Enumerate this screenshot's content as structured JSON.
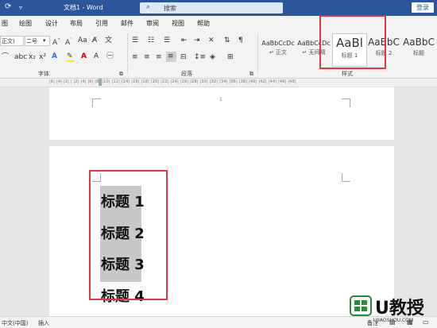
{
  "titlebar": {
    "save_icon": "save-icon",
    "dropdown_icon": "dropdown-icon",
    "title": "文档1 - Word",
    "search_placeholder": "搜索",
    "login_label": "登录"
  },
  "tabs": [
    "图",
    "绘图",
    "设计",
    "布局",
    "引用",
    "邮件",
    "审阅",
    "视图",
    "帮助"
  ],
  "ribbon": {
    "font_name": "正文)",
    "font_size": "二号",
    "font_group_label": "字体",
    "paragraph_group_label": "段落",
    "styles_group_label": "样式",
    "styles": [
      {
        "preview": "AaBbCcDc",
        "name": "↵ 正文"
      },
      {
        "preview": "AaBbCcDc",
        "name": "↵ 无间隔"
      },
      {
        "preview": "AaBl",
        "name": "标题 1"
      },
      {
        "preview": "AaBbC",
        "name": "标题 2"
      },
      {
        "preview": "AaBbC",
        "name": "标题"
      }
    ]
  },
  "ruler": {
    "ticks": "|6| |4| |2| | |2| |4| |6| |8| |10| |12| |14| |16| |18| |20| |22| |24| |26| |28| |30| |32| |34| |36| |38| |40| |42| |44| |46| |48|"
  },
  "document": {
    "page1_number": "1",
    "headings": [
      "标题 1",
      "标题 2",
      "标题 3",
      "标题 4"
    ]
  },
  "status": {
    "language": "中文(中国)",
    "mode": "插入",
    "notes_label": "备注"
  },
  "watermark": {
    "brand": "U教授",
    "url": "UJIAOSHOU.COM"
  },
  "colors": {
    "accent": "#2b579a",
    "highlight_box": "#d83b3b",
    "selection": "#c8c8c8"
  }
}
